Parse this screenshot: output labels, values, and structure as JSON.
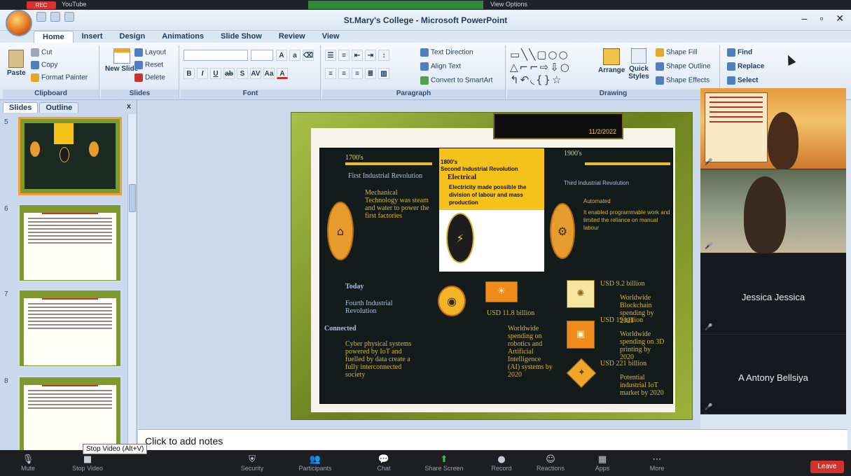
{
  "window": {
    "title": "St.Mary's College - Microsoft PowerPoint",
    "zoom_badge": "YouTube",
    "view_options": "View Options"
  },
  "tabs": [
    "Home",
    "Insert",
    "Design",
    "Animations",
    "Slide Show",
    "Review",
    "View"
  ],
  "ribbon": {
    "clipboard": {
      "paste": "Paste",
      "cut": "Cut",
      "copy": "Copy",
      "format_painter": "Format Painter",
      "label": "Clipboard"
    },
    "slides": {
      "layout": "Layout",
      "reset": "Reset",
      "new_slide": "New Slide",
      "delete": "Delete",
      "label": "Slides"
    },
    "font": {
      "label": "Font"
    },
    "paragraph": {
      "text_direction": "Text Direction",
      "align_text": "Align Text",
      "convert_smartart": "Convert to SmartArt",
      "label": "Paragraph"
    },
    "drawing": {
      "arrange": "Arrange",
      "quick_styles": "Quick Styles",
      "shape_fill": "Shape Fill",
      "shape_outline": "Shape Outline",
      "shape_effects": "Shape Effects",
      "label": "Drawing"
    },
    "editing": {
      "find": "Find",
      "replace": "Replace",
      "select": "Select"
    }
  },
  "pane": {
    "tab_slides": "Slides",
    "tab_outline": "Outline",
    "close": "x",
    "slide_numbers": [
      "5",
      "6",
      "7",
      "8"
    ]
  },
  "slide": {
    "date": "11/2/2022",
    "col1": {
      "era": "1700's",
      "title": "First Industrial Revolution",
      "body": "Mechanical Technology was steam and water to power the first factories"
    },
    "col2": {
      "era": "1800's",
      "title": "Second Industrial Revolution",
      "subtitle": "Electrical",
      "body": "Electricity made possible the division of labour and mass production"
    },
    "col3": {
      "era": "1900's",
      "title": "Third Industrial Revolution",
      "subtitle": "Automated",
      "body": "It enabled programmable work and limited the reliance on manual labour"
    },
    "today": {
      "label": "Today",
      "fourth": "Fourth Industrial Revolution",
      "connected": "Connected",
      "body": "Cyber physical systems powered by IoT and fuelled by data create a fully interconnected society"
    },
    "stats": {
      "s1_value": "USD 11.8 billion",
      "s1_text": "Worldwide spending on robotics and Artificial Intelligence (AI) systems by 2020",
      "s2_value": "USD 9.2 billion",
      "s2_text": "Worldwide Blockchain spending by 2021",
      "s3_value": "USD 19 billion",
      "s3_text": "Worldwide spending on 3D printing by 2020",
      "s4_value": "USD 221 billion",
      "s4_text": "Potential industrial IoT market by 2020"
    }
  },
  "notes": {
    "placeholder": "Click to add notes"
  },
  "tooltip": "Stop Video (Alt+V)",
  "participants": [
    {
      "name": "Jessica Jessica"
    },
    {
      "name": "A Antony Bellsiya"
    }
  ],
  "zoombar": {
    "items": [
      "Mute",
      "Stop Video",
      "Security",
      "Participants",
      "Chat",
      "Share Screen",
      "Record",
      "Reactions",
      "Apps",
      "More"
    ],
    "leave": "Leave"
  },
  "colors": {
    "accent": "#f4c21a",
    "slide_frame": "#8da632",
    "dark_bg": "#131c1a",
    "leave": "#d0332e"
  }
}
